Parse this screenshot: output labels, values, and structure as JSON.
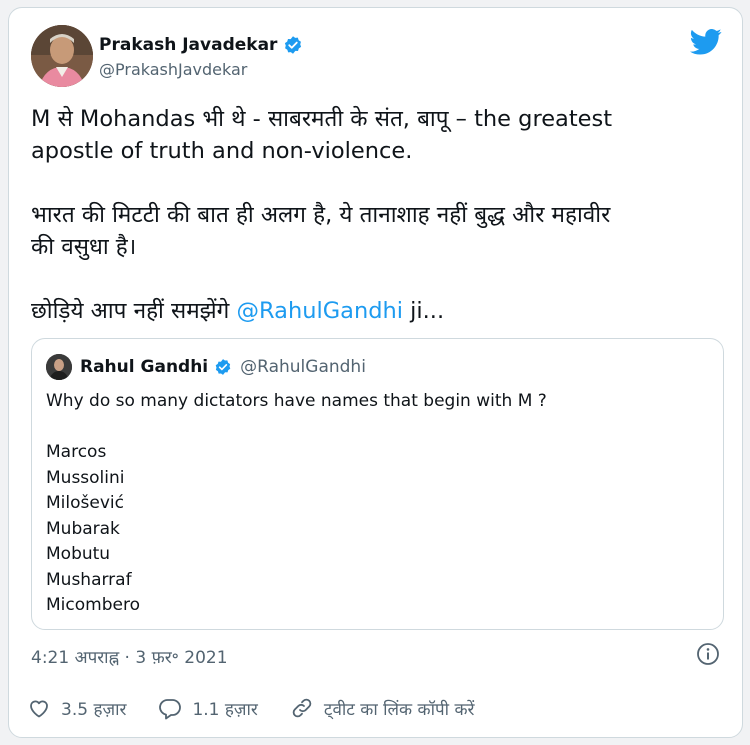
{
  "tweet": {
    "author": {
      "name": "Prakash Javadekar",
      "handle": "@PrakashJavdekar",
      "verified": true
    },
    "text": {
      "line1": "M से Mohandas भी थे - साबरमती के संत, बापू – the greatest",
      "line2": "apostle of truth and non-violence.",
      "line3": "भारत की मिटटी की बात ही अलग है, ये तानाशाह नहीं बुद्ध और महावीर",
      "line4": "की वसुधा है।",
      "line5_prefix": "छोड़िये आप नहीं समझेंगे ",
      "line5_mention": "@RahulGandhi",
      "line5_suffix": " ji..."
    },
    "timestamp": "4:21 अपराह्न · 3 फ़र॰ 2021",
    "actions": {
      "likes": "3.5 हज़ार",
      "replies": "1.1 हज़ार",
      "copy_link": "ट्वीट का लिंक कॉपी करें"
    }
  },
  "quoted_tweet": {
    "author": {
      "name": "Rahul Gandhi",
      "handle": "@RahulGandhi",
      "verified": true
    },
    "intro": "Why do so many dictators have names that begin with M ?",
    "names": [
      "Marcos",
      "Mussolini",
      "Milošević",
      "Mubarak",
      "Mobutu",
      "Musharraf",
      "Micombero"
    ]
  },
  "icons": {
    "brand": "twitter-bird-icon",
    "verified": "verified-badge-icon",
    "info": "info-icon",
    "like": "heart-icon",
    "reply": "reply-bubble-icon",
    "link": "link-icon"
  },
  "colors": {
    "brand": "#1d9bf0",
    "text": "#0f1419",
    "muted": "#536471",
    "border": "#cfd9de"
  }
}
